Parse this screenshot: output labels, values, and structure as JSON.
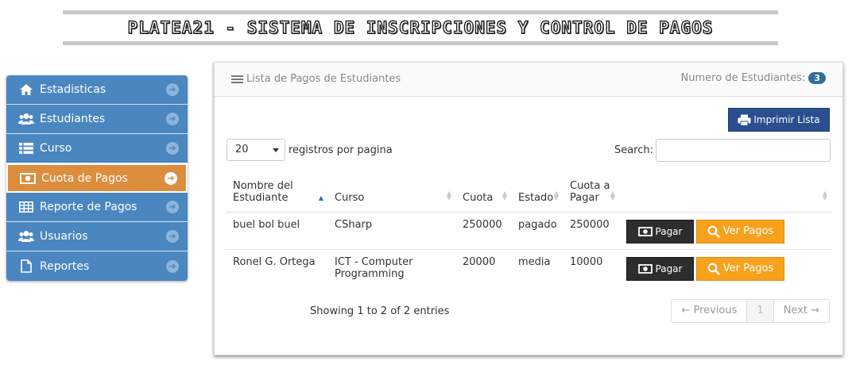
{
  "banner": {
    "title": "Platea21 - Sistema de Inscripciones y Control de Pagos"
  },
  "sidebar": {
    "items": [
      {
        "label": "Estadisticas",
        "icon": "home-icon"
      },
      {
        "label": "Estudiantes",
        "icon": "users-icon"
      },
      {
        "label": "Curso",
        "icon": "list-icon"
      },
      {
        "label": "Cuota de Pagos",
        "icon": "money-icon",
        "active": true
      },
      {
        "label": "Reporte de Pagos",
        "icon": "table-icon"
      },
      {
        "label": "Usuarios",
        "icon": "users-icon"
      },
      {
        "label": "Reportes",
        "icon": "file-icon"
      }
    ]
  },
  "panel": {
    "title": "Lista de Pagos de Estudiantes",
    "count_label": "Numero de Estudiantes:",
    "count": "3",
    "print_button": "Imprimir Lista"
  },
  "table_controls": {
    "page_size": "20",
    "page_size_suffix": "registros por pagina",
    "search_label": "Search:"
  },
  "table": {
    "headers": [
      "Nombre del Estudiante",
      "Curso",
      "Cuota",
      "Estado",
      "Cuota a Pagar",
      ""
    ],
    "rows": [
      {
        "nombre": "buel bol buel",
        "curso": "CSharp",
        "cuota": "250000",
        "estado": "pagado",
        "cuota_pagar": "250000"
      },
      {
        "nombre": "Ronel G. Ortega",
        "curso": "ICT - Computer Programming",
        "cuota": "20000",
        "estado": "media",
        "cuota_pagar": "10000"
      }
    ],
    "pay_button": "Pagar",
    "view_button": "Ver Pagos"
  },
  "footer": {
    "info": "Showing 1 to 2 of 2 entries",
    "prev": "← Previous",
    "current_page": "1",
    "next": "Next →"
  },
  "colors": {
    "sidebar": "#4a86c0",
    "sidebar_active": "#dc8e3e",
    "print_button": "#2b4f8e",
    "pay_button": "#2d2d2d",
    "view_button": "#f7a11d"
  }
}
